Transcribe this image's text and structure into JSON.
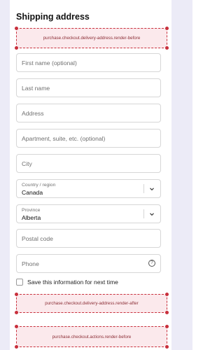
{
  "section": {
    "title": "Shipping address"
  },
  "extensions": {
    "delivery_before": "purchase.checkout.delivery-address.render-before",
    "delivery_after": "purchase.checkout.delivery-address.render-after",
    "actions_before": "purchase.checkout.actions.render-before"
  },
  "fields": {
    "first_name": {
      "placeholder": "First name (optional)"
    },
    "last_name": {
      "placeholder": "Last name"
    },
    "address": {
      "placeholder": "Address"
    },
    "apartment": {
      "placeholder": "Apartment, suite, etc. (optional)"
    },
    "city": {
      "placeholder": "City"
    },
    "country": {
      "label": "Country / region",
      "value": "Canada"
    },
    "province": {
      "label": "Province",
      "value": "Alberta"
    },
    "postal": {
      "placeholder": "Postal code"
    },
    "phone": {
      "placeholder": "Phone"
    }
  },
  "save_info": {
    "label": "Save this information for next time",
    "checked": false
  },
  "icons": {
    "help": "question-circle-icon",
    "chevron": "chevron-down-icon"
  },
  "colors": {
    "extension_border": "#c8303c",
    "extension_bg": "#fbe9ec",
    "page_stripe": "#ecebf7"
  }
}
